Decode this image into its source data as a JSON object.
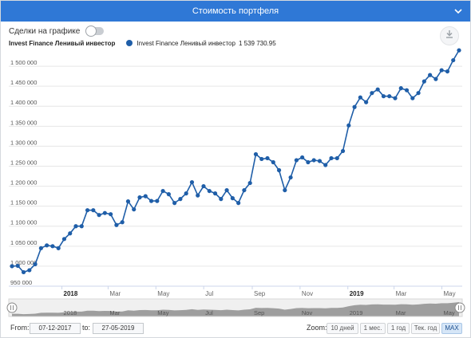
{
  "header": {
    "title": "Стоимость портфеля"
  },
  "toolbar": {
    "deals_toggle_label": "Сделки на графике"
  },
  "legend": {
    "series_label": "Invest Finance Ленивый инвестор",
    "entry_name": "Invest Finance Ленивый инвестор",
    "entry_value": "1 539 730.95"
  },
  "colors": {
    "header": "#2f78d6",
    "series": "#1f5ea8",
    "active_zoom": "#d6e6f7"
  },
  "icons": {
    "header": "chevron-down-icon",
    "export": "download-icon"
  },
  "chart_data": {
    "type": "line",
    "series": [
      {
        "name": "Invest Finance Ленивый инвестор",
        "values": [
          1000000,
          1001000,
          985000,
          990000,
          1005000,
          1045000,
          1052000,
          1050000,
          1045000,
          1068000,
          1082000,
          1100000,
          1100000,
          1140000,
          1140000,
          1128000,
          1133000,
          1130000,
          1103000,
          1110000,
          1162000,
          1142000,
          1172000,
          1175000,
          1163000,
          1163000,
          1188000,
          1180000,
          1158000,
          1168000,
          1182000,
          1210000,
          1177000,
          1200000,
          1188000,
          1182000,
          1168000,
          1190000,
          1170000,
          1158000,
          1190000,
          1208000,
          1280000,
          1268000,
          1270000,
          1260000,
          1240000,
          1190000,
          1222000,
          1265000,
          1272000,
          1260000,
          1265000,
          1263000,
          1253000,
          1270000,
          1270000,
          1288000,
          1352000,
          1398000,
          1422000,
          1410000,
          1433000,
          1442000,
          1425000,
          1425000,
          1420000,
          1445000,
          1440000,
          1420000,
          1433000,
          1462000,
          1478000,
          1468000,
          1490000,
          1487000,
          1515000,
          1539731
        ]
      }
    ],
    "y_ticks": [
      "950 000",
      "1 000 000",
      "1 050 000",
      "1 100 000",
      "1 150 000",
      "1 200 000",
      "1 250 000",
      "1 300 000",
      "1 350 000",
      "1 400 000",
      "1 450 000",
      "1 500 000"
    ],
    "y_tick_values": [
      950000,
      1000000,
      1050000,
      1100000,
      1150000,
      1200000,
      1250000,
      1300000,
      1350000,
      1400000,
      1450000,
      1500000
    ],
    "ylim": [
      950000,
      1540000
    ],
    "x_range": [
      "2017-12-07",
      "2019-05-27"
    ],
    "x_ticks": [
      {
        "label": "2018",
        "date": "2018-01-01",
        "bold": true
      },
      {
        "label": "Mar",
        "date": "2018-03-01",
        "bold": false
      },
      {
        "label": "May",
        "date": "2018-05-01",
        "bold": false
      },
      {
        "label": "Jul",
        "date": "2018-07-01",
        "bold": false
      },
      {
        "label": "Sep",
        "date": "2018-09-01",
        "bold": false
      },
      {
        "label": "Nov",
        "date": "2018-11-01",
        "bold": false
      },
      {
        "label": "2019",
        "date": "2019-01-01",
        "bold": true
      },
      {
        "label": "Mar",
        "date": "2019-03-01",
        "bold": false
      },
      {
        "label": "May",
        "date": "2019-05-01",
        "bold": false
      }
    ],
    "grid": true,
    "legend_position": "top-left"
  },
  "navigator": {
    "ticks": [
      {
        "label": "2018",
        "date": "2018-01-01"
      },
      {
        "label": "Mar",
        "date": "2018-03-01"
      },
      {
        "label": "May",
        "date": "2018-05-01"
      },
      {
        "label": "Jul",
        "date": "2018-07-01"
      },
      {
        "label": "Sep",
        "date": "2018-09-01"
      },
      {
        "label": "Nov",
        "date": "2018-11-01"
      },
      {
        "label": "2019",
        "date": "2019-01-01"
      },
      {
        "label": "Mar",
        "date": "2019-03-01"
      },
      {
        "label": "May",
        "date": "2019-05-01"
      }
    ]
  },
  "range": {
    "from_label": "From:",
    "from_value": "07-12-2017",
    "to_label": "to:",
    "to_value": "27-05-2019"
  },
  "zoom": {
    "label": "Zoom:",
    "buttons": [
      "10 дней",
      "1 мес.",
      "1 год",
      "Тек. год",
      "MAX"
    ],
    "active": "MAX"
  }
}
